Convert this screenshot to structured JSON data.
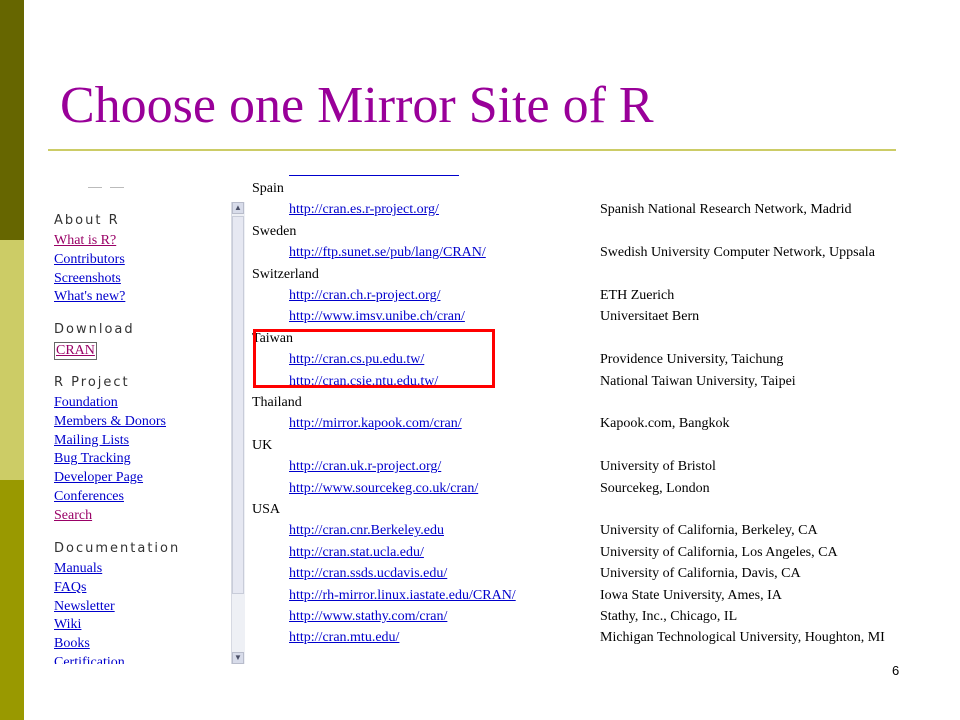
{
  "slide": {
    "title": "Choose one Mirror Site of R",
    "page_number": "6",
    "colors": {
      "title": "#990099",
      "bar_dark": "#666600",
      "bar_light": "#CCCC66",
      "bar_mid": "#999900",
      "highlight": "#ff0000",
      "link": "#0000cc",
      "visited": "#990066"
    }
  },
  "sidebar": {
    "sections": [
      {
        "heading": "About R",
        "links": [
          "What is R?",
          "Contributors",
          "Screenshots",
          "What's new?"
        ]
      },
      {
        "heading": "Download",
        "links": [
          "CRAN"
        ]
      },
      {
        "heading": "R Project",
        "links": [
          "Foundation",
          "Members & Donors",
          "Mailing Lists",
          "Bug Tracking",
          "Developer Page",
          "Conferences",
          "Search"
        ]
      },
      {
        "heading": "Documentation",
        "links": [
          "Manuals",
          "FAQs",
          "Newsletter",
          "Wiki",
          "Books",
          "Certification"
        ]
      }
    ],
    "scroll_up": "▲",
    "scroll_down": "▼"
  },
  "mirrors": [
    {
      "type": "country",
      "text": "Spain"
    },
    {
      "type": "mirror",
      "url": "http://cran.es.r-project.org/",
      "institution": "Spanish National Research Network, Madrid"
    },
    {
      "type": "country",
      "text": "Sweden"
    },
    {
      "type": "mirror",
      "url": "http://ftp.sunet.se/pub/lang/CRAN/",
      "institution": "Swedish University Computer Network, Uppsala"
    },
    {
      "type": "country",
      "text": "Switzerland"
    },
    {
      "type": "mirror",
      "url": "http://cran.ch.r-project.org/",
      "institution": "ETH Zuerich"
    },
    {
      "type": "mirror",
      "url": "http://www.imsv.unibe.ch/cran/",
      "institution": "Universitaet Bern"
    },
    {
      "type": "country",
      "text": "Taiwan"
    },
    {
      "type": "mirror",
      "url": "http://cran.cs.pu.edu.tw/",
      "institution": "Providence University, Taichung"
    },
    {
      "type": "mirror",
      "url": "http://cran.csie.ntu.edu.tw/",
      "institution": "National Taiwan University, Taipei"
    },
    {
      "type": "country",
      "text": "Thailand"
    },
    {
      "type": "mirror",
      "url": "http://mirror.kapook.com/cran/",
      "institution": "Kapook.com, Bangkok"
    },
    {
      "type": "country",
      "text": "UK"
    },
    {
      "type": "mirror",
      "url": "http://cran.uk.r-project.org/",
      "institution": "University of Bristol"
    },
    {
      "type": "mirror",
      "url": "http://www.sourcekeg.co.uk/cran/",
      "institution": "Sourcekeg, London"
    },
    {
      "type": "country",
      "text": "USA"
    },
    {
      "type": "mirror",
      "url": "http://cran.cnr.Berkeley.edu",
      "institution": "University of California, Berkeley, CA"
    },
    {
      "type": "mirror",
      "url": "http://cran.stat.ucla.edu/",
      "institution": "University of California, Los Angeles, CA"
    },
    {
      "type": "mirror",
      "url": "http://cran.ssds.ucdavis.edu/",
      "institution": "University of California, Davis, CA"
    },
    {
      "type": "mirror",
      "url": "http://rh-mirror.linux.iastate.edu/CRAN/",
      "institution": "Iowa State University, Ames, IA"
    },
    {
      "type": "mirror",
      "url": "http://www.stathy.com/cran/",
      "institution": "Stathy, Inc., Chicago, IL"
    },
    {
      "type": "mirror",
      "url": "http://cran.mtu.edu/",
      "institution": "Michigan Technological University, Houghton, MI"
    }
  ]
}
